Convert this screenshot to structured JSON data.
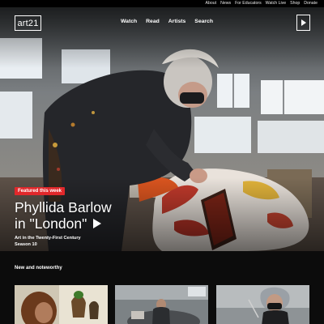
{
  "topbar": {
    "links": [
      "About",
      "News",
      "For Educators",
      "Watch Live",
      "Shop",
      "Donate"
    ]
  },
  "brand": {
    "logo_text": "art21"
  },
  "nav": {
    "items": [
      "Watch",
      "Read",
      "Artists",
      "Search"
    ]
  },
  "feature": {
    "badge": "Featured this week",
    "title_line1": "Phyllida Barlow",
    "title_line2": "in \"London\"",
    "series": "Art in the Twenty-First Century",
    "season": "Season 10"
  },
  "section": {
    "heading": "New and noteworthy"
  },
  "icons": {
    "play_square": "play-icon",
    "feature_play": "play-icon"
  },
  "colors": {
    "badge": "#e1282b",
    "background": "#000000"
  }
}
